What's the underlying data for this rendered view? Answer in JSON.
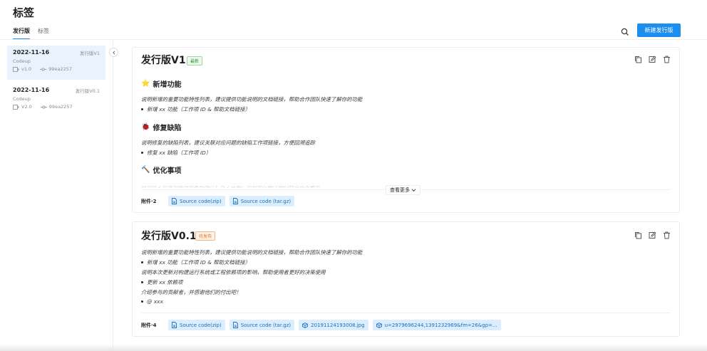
{
  "page": {
    "title": "标签"
  },
  "tabs": [
    {
      "label": "发行版"
    },
    {
      "label": "标签"
    }
  ],
  "toolbar": {
    "new_release_label": "新建发行版"
  },
  "sidebar": {
    "items": [
      {
        "date": "2022-11-16",
        "name": "发行版V1",
        "repo": "Codeup",
        "tag": "v1.0",
        "commit": "99ea2257"
      },
      {
        "date": "2022-11-16",
        "name": "发行版V0.1",
        "repo": "Codeup",
        "tag": "V2.0",
        "commit": "99ea2257"
      }
    ]
  },
  "release1": {
    "title": "发行版V1",
    "badge": "最新",
    "sections": [
      {
        "emoji": "⭐",
        "heading": "新增功能",
        "desc": "说明新增的重要功能特性列表，建议提供功能说明的文档链接，帮助合作团队快速了解你的功能",
        "bullet": "新增 xx 功能（工作项 ID & 帮助文档链接）"
      },
      {
        "emoji": "🐞",
        "heading": "修复缺陷",
        "desc": "说明修复的缺陷列表，建议关联对应问题的缺陷工作项链接，方便回溯追踪",
        "bullet": "修复 xx 缺陷（工作项 ID）"
      },
      {
        "emoji": "🔨",
        "heading": "优化事项",
        "desc": "说明除了新增功能和修复缺陷外，对于性能、依赖等方面所做的其他优化事项"
      }
    ],
    "more_label": "查看更多",
    "attachments_label": "附件·2",
    "attachments": [
      "Source code(zip)",
      "Source code (tar.gz)"
    ]
  },
  "release2": {
    "title": "发行版V0.1",
    "badge": "待发布",
    "lines": {
      "l1": "说明新增的重要功能特性列表，建议提供功能说明的文档链接，帮助合作团队快速了解你的功能",
      "b1": "新增 xx 功能（工作项 ID & 帮助文档链接）",
      "l2": "说明本次更新对构建运行系统或工程依赖项的影响，帮助使用者更好的决策使用",
      "b2": "更新 xx 依赖项",
      "l3": "介绍参与的贡献者，并感谢他们的付出吧！",
      "b3": "@ xxx"
    },
    "attachments_label": "附件·4",
    "attachments": [
      "Source code(zip)",
      "Source code (tar.gz)",
      "20191124193008.jpg",
      "u=2979696244,1391232969&fm=26&gp=..."
    ]
  },
  "colors": {
    "accent": "#1b8ef0",
    "latest": "#2a9a33",
    "pending": "#e37318",
    "selected_bg": "#e8f3fd"
  }
}
